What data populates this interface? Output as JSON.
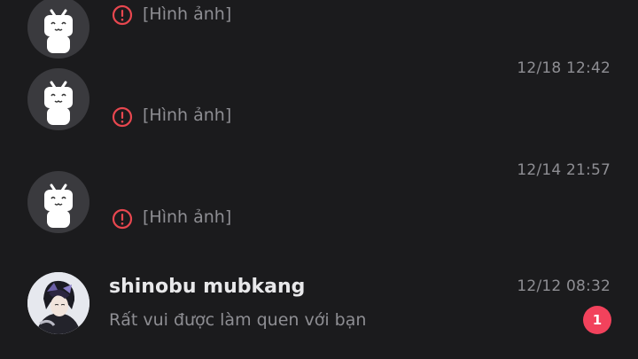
{
  "conversations": [
    {
      "timestamp": "",
      "message": "[Hình ảnh]",
      "failed": true,
      "avatar_icon": "bilibili-tv-mascot-icon"
    },
    {
      "timestamp": "12/18 12:42",
      "message": "[Hình ảnh]",
      "failed": true,
      "avatar_icon": "bilibili-tv-mascot-icon"
    },
    {
      "timestamp": "12/14 21:57",
      "message": "[Hình ảnh]",
      "failed": true,
      "avatar_icon": "bilibili-tv-mascot-icon"
    },
    {
      "name": "shinobu mubkang",
      "timestamp": "12/12 08:32",
      "preview": "Rất vui được làm quen với bạn",
      "unread_count": "1",
      "avatar_icon": "user-photo-avatar"
    }
  ],
  "colors": {
    "background": "#1b1b1d",
    "error_red": "#e8474f",
    "badge_red": "#f2425c",
    "muted_text": "#8e8e93",
    "name_text": "#e8e8ea"
  }
}
